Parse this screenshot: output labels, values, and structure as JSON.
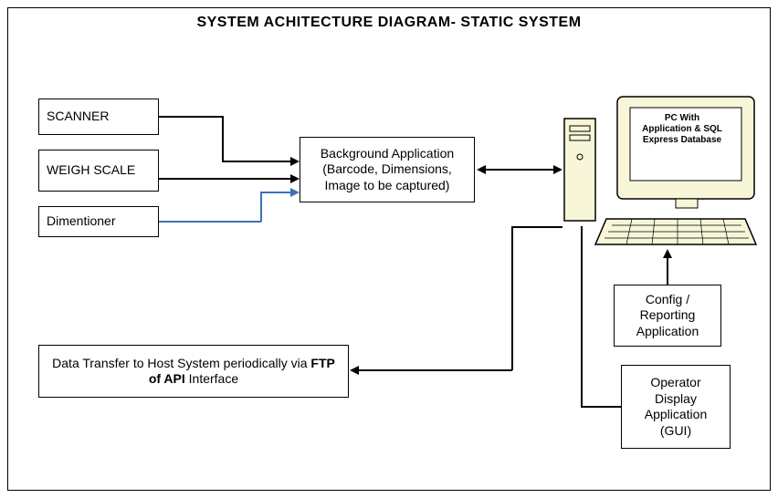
{
  "title": "SYSTEM ACHITECTURE DIAGRAM- STATIC SYSTEM",
  "nodes": {
    "scanner": "SCANNER",
    "weigh_scale": "WEIGH SCALE",
    "dimentioner": "Dimentioner",
    "background_app": "Background Application (Barcode, Dimensions, Image to be captured)",
    "pc_label": "PC With Application & SQL Express Database",
    "config_reporting": "Config / Reporting Application",
    "operator_display": "Operator Display Application (GUI)",
    "data_transfer_prefix": "Data Transfer to Host System periodically via ",
    "data_transfer_bold": "FTP of API",
    "data_transfer_suffix": " Interface"
  },
  "edges": [
    {
      "from": "scanner",
      "to": "background_app",
      "style": "black"
    },
    {
      "from": "weigh_scale",
      "to": "background_app",
      "style": "black"
    },
    {
      "from": "dimentioner",
      "to": "background_app",
      "style": "blue"
    },
    {
      "from": "background_app",
      "to": "pc",
      "style": "black",
      "bidirectional": true
    },
    {
      "from": "config_reporting",
      "to": "pc",
      "style": "black"
    },
    {
      "from": "operator_display",
      "to": "pc",
      "style": "black"
    },
    {
      "from": "pc",
      "to": "data_transfer",
      "style": "black"
    }
  ]
}
